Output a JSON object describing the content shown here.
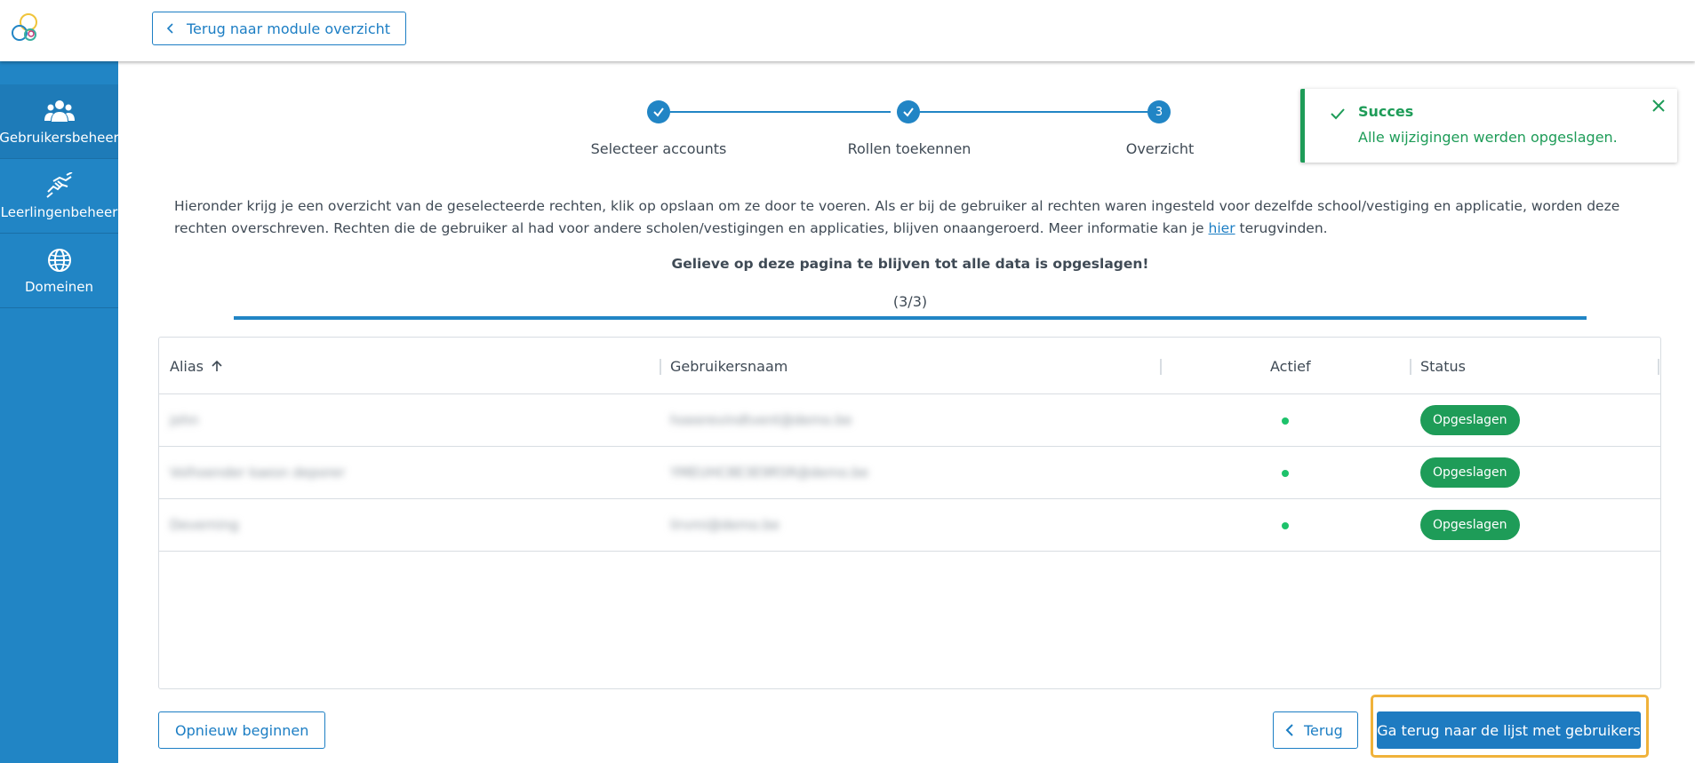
{
  "header": {
    "back_button_label": "Terug naar module overzicht"
  },
  "sidebar": {
    "items": [
      {
        "label": "Gebruikersbeheer",
        "icon": "users-icon"
      },
      {
        "label": "Leerlingenbeheer",
        "icon": "handshake-icon"
      },
      {
        "label": "Domeinen",
        "icon": "globe-icon"
      }
    ]
  },
  "stepper": {
    "steps": [
      {
        "label": "Selecteer accounts",
        "state": "done"
      },
      {
        "label": "Rollen toekennen",
        "state": "done"
      },
      {
        "label": "Overzicht",
        "state": "current",
        "number": "3"
      }
    ]
  },
  "toast": {
    "title": "Succes",
    "message": "Alle wijzigingen werden opgeslagen."
  },
  "intro": {
    "text_part1": "Hieronder krijg je een overzicht van de geselecteerde rechten, klik op opslaan om ze door te voeren. Als er bij de gebruiker al rechten waren ingesteld voor dezelfde school/vestiging en applicatie, worden deze rechten overschreven. Rechten die de gebruiker al had voor andere scholen/vestigingen en applicaties, blijven onaangeroerd. Meer informatie kan je ",
    "link": "hier",
    "text_part2": " terugvinden."
  },
  "warning": "Gelieve op deze pagina te blijven tot alle data is opgeslagen!",
  "progress": {
    "label": "(3/3)",
    "fraction": 1.0
  },
  "table": {
    "columns": [
      "Alias",
      "Gebruikersnaam",
      "Actief",
      "Status"
    ],
    "rows": [
      {
        "alias": "john",
        "username": "hoeerevindtvent@demo.be",
        "active": true,
        "status": "Opgeslagen"
      },
      {
        "alias": "Volhoender kaesn deporer",
        "username": "YMEUHC8E3E9R5R@demo.be",
        "active": true,
        "status": "Opgeslagen"
      },
      {
        "alias": "Deverning",
        "username": "lirvmi@demo.be",
        "active": true,
        "status": "Opgeslagen"
      }
    ]
  },
  "footer": {
    "restart_label": "Opnieuw beginnen",
    "back_label": "Terug",
    "primary_label": "Ga terug naar de lijst met gebruikers"
  },
  "colors": {
    "primary": "#2185c5",
    "success": "#1e9c58",
    "highlight": "#f0b23a"
  }
}
